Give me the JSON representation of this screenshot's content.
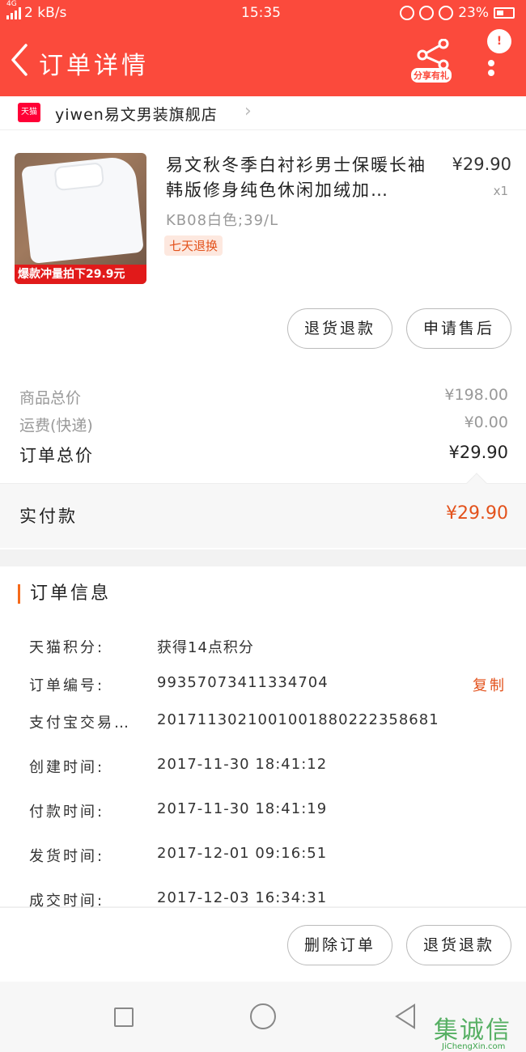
{
  "status_bar": {
    "network": "4G",
    "speed": "2 kB/s",
    "time": "15:35",
    "battery": "23%"
  },
  "header": {
    "title": "订单详情",
    "share_label": "分享有礼",
    "notification_count": "!"
  },
  "shop": {
    "badge": "天猫",
    "name": "yiwen易文男装旗舰店"
  },
  "product": {
    "image_banner": "爆款冲量拍下29.9元",
    "title": "易文秋冬季白衬衫男士保暖长袖韩版修身纯色休闲加绒加…",
    "price": "¥29.90",
    "quantity": "x1",
    "sku": "KB08白色;39/L",
    "tag": "七天退换"
  },
  "item_actions": {
    "refund_label": "退货退款",
    "after_sale_label": "申请售后"
  },
  "summary": {
    "goods_total_label": "商品总价",
    "goods_total_value": "¥198.00",
    "shipping_label": "运费(快递)",
    "shipping_value": "¥0.00",
    "order_total_label": "订单总价",
    "order_total_value": "¥29.90",
    "paid_label": "实付款",
    "paid_value": "¥29.90"
  },
  "order_info": {
    "title": "订单信息",
    "copy_label": "复制",
    "rows": [
      {
        "label": "天猫积分:",
        "value": "获得14点积分"
      },
      {
        "label": "订单编号:",
        "value": "99357073411334704"
      },
      {
        "label": "支付宝交易…",
        "value": "2017113021001001880222358681"
      },
      {
        "label": "创建时间:",
        "value": "2017-11-30 18:41:12"
      },
      {
        "label": "付款时间:",
        "value": "2017-11-30 18:41:19"
      },
      {
        "label": "发货时间:",
        "value": "2017-12-01 09:16:51"
      },
      {
        "label": "成交时间:",
        "value": "2017-12-03 16:34:31"
      }
    ]
  },
  "bottom_actions": {
    "delete_label": "删除订单",
    "refund_label": "退货退款"
  },
  "watermark": {
    "zh": "集诚信",
    "en": "JiChengXin.com"
  },
  "colors": {
    "header": "#fb4a3c",
    "accent": "#e3521c"
  }
}
